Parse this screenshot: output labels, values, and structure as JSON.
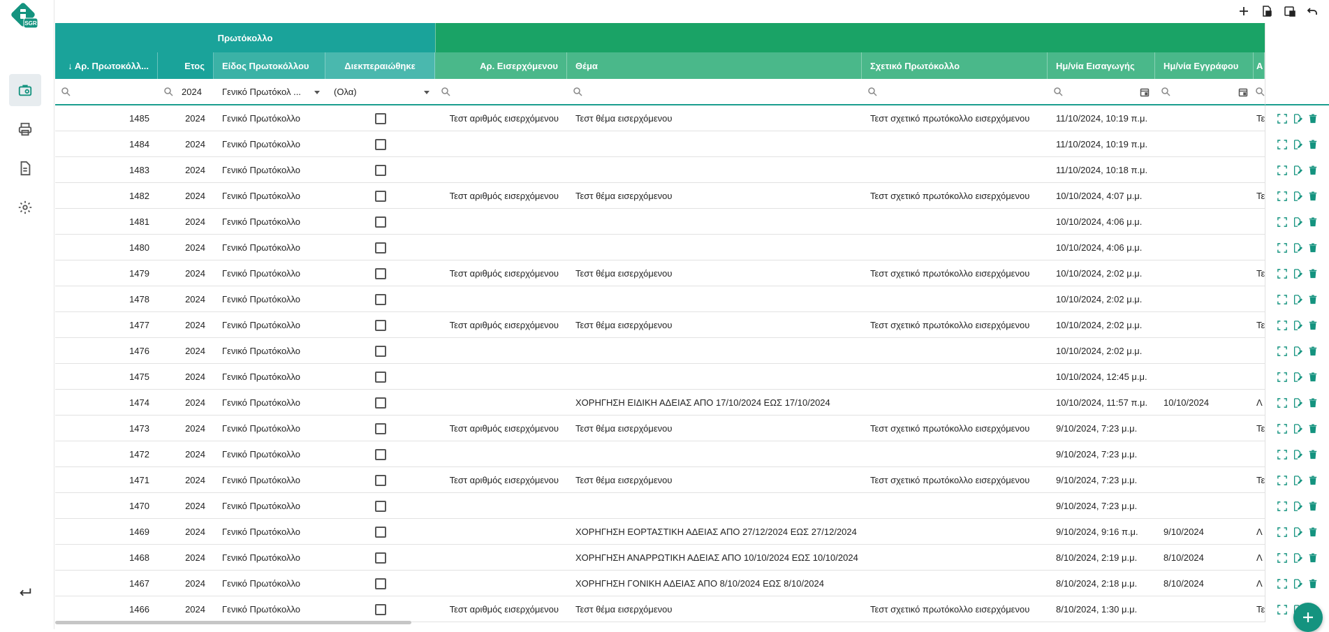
{
  "app": {
    "logo_text": "SGR",
    "accent": "#1a9e8e",
    "accent_dark": "#14937f"
  },
  "sidebar": {
    "items": [
      {
        "icon": "briefcase-icon",
        "active": true
      },
      {
        "icon": "printer-icon",
        "active": false
      },
      {
        "icon": "document-icon",
        "active": false
      },
      {
        "icon": "gear-icon",
        "active": false
      }
    ],
    "bottom_icon": "enter-arrow-icon"
  },
  "toolbar": {
    "icons": [
      "plus-icon",
      "export-icon",
      "layout-icon",
      "undo-icon"
    ]
  },
  "grid": {
    "groups": [
      {
        "label": "Πρωτόκολλο",
        "color": "#1aa39a"
      },
      {
        "label": "",
        "color": "#1aa366"
      }
    ],
    "columns": [
      {
        "label": "↓ Αρ. Πρωτοκόλλ..."
      },
      {
        "label": "Ετος"
      },
      {
        "label": "Είδος Πρωτοκόλλου"
      },
      {
        "label": "Διεκπεραιώθηκε"
      },
      {
        "label": "Αρ. Εισερχόμενου"
      },
      {
        "label": "Θέμα"
      },
      {
        "label": "Σχετικό Πρωτόκολλο"
      },
      {
        "label": "Ημ/νία Εισαγωγής"
      },
      {
        "label": "Ημ/νία Εγγράφου"
      },
      {
        "label": "Α"
      }
    ],
    "filters": {
      "year": "2024",
      "kind": "Γενικό Πρωτόκολ ...",
      "done": "(Ολα)"
    },
    "rows": [
      {
        "no": "1485",
        "year": "2024",
        "kind": "Γενικό Πρωτόκολλο",
        "inc": "Τεστ αριθμός εισερχόμενου",
        "subject": "Τεστ θέμα εισερχόμενου",
        "rel": "Τεστ σχετικό πρωτόκολλο εισερχόμενου",
        "ins": "11/10/2024, 10:19 π.μ.",
        "doc": "",
        "extra": "Τε"
      },
      {
        "no": "1484",
        "year": "2024",
        "kind": "Γενικό Πρωτόκολλο",
        "inc": "",
        "subject": "",
        "rel": "",
        "ins": "11/10/2024, 10:19 π.μ.",
        "doc": "",
        "extra": ""
      },
      {
        "no": "1483",
        "year": "2024",
        "kind": "Γενικό Πρωτόκολλο",
        "inc": "",
        "subject": "",
        "rel": "",
        "ins": "11/10/2024, 10:18 π.μ.",
        "doc": "",
        "extra": ""
      },
      {
        "no": "1482",
        "year": "2024",
        "kind": "Γενικό Πρωτόκολλο",
        "inc": "Τεστ αριθμός εισερχόμενου",
        "subject": "Τεστ θέμα εισερχόμενου",
        "rel": "Τεστ σχετικό πρωτόκολλο εισερχόμενου",
        "ins": "10/10/2024, 4:07 μ.μ.",
        "doc": "",
        "extra": "Τε"
      },
      {
        "no": "1481",
        "year": "2024",
        "kind": "Γενικό Πρωτόκολλο",
        "inc": "",
        "subject": "",
        "rel": "",
        "ins": "10/10/2024, 4:06 μ.μ.",
        "doc": "",
        "extra": ""
      },
      {
        "no": "1480",
        "year": "2024",
        "kind": "Γενικό Πρωτόκολλο",
        "inc": "",
        "subject": "",
        "rel": "",
        "ins": "10/10/2024, 4:06 μ.μ.",
        "doc": "",
        "extra": ""
      },
      {
        "no": "1479",
        "year": "2024",
        "kind": "Γενικό Πρωτόκολλο",
        "inc": "Τεστ αριθμός εισερχόμενου",
        "subject": "Τεστ θέμα εισερχόμενου",
        "rel": "Τεστ σχετικό πρωτόκολλο εισερχόμενου",
        "ins": "10/10/2024, 2:02 μ.μ.",
        "doc": "",
        "extra": "Τε"
      },
      {
        "no": "1478",
        "year": "2024",
        "kind": "Γενικό Πρωτόκολλο",
        "inc": "",
        "subject": "",
        "rel": "",
        "ins": "10/10/2024, 2:02 μ.μ.",
        "doc": "",
        "extra": ""
      },
      {
        "no": "1477",
        "year": "2024",
        "kind": "Γενικό Πρωτόκολλο",
        "inc": "Τεστ αριθμός εισερχόμενου",
        "subject": "Τεστ θέμα εισερχόμενου",
        "rel": "Τεστ σχετικό πρωτόκολλο εισερχόμενου",
        "ins": "10/10/2024, 2:02 μ.μ.",
        "doc": "",
        "extra": "Τε"
      },
      {
        "no": "1476",
        "year": "2024",
        "kind": "Γενικό Πρωτόκολλο",
        "inc": "",
        "subject": "",
        "rel": "",
        "ins": "10/10/2024, 2:02 μ.μ.",
        "doc": "",
        "extra": ""
      },
      {
        "no": "1475",
        "year": "2024",
        "kind": "Γενικό Πρωτόκολλο",
        "inc": "",
        "subject": "",
        "rel": "",
        "ins": "10/10/2024, 12:45 μ.μ.",
        "doc": "",
        "extra": ""
      },
      {
        "no": "1474",
        "year": "2024",
        "kind": "Γενικό Πρωτόκολλο",
        "inc": "",
        "subject": "ΧΟΡΗΓΗΣΗ ΕΙΔΙΚΗ ΑΔΕΙΑΣ ΑΠΟ 17/10/2024 ΕΩΣ 17/10/2024",
        "rel": "",
        "ins": "10/10/2024, 11:57 π.μ.",
        "doc": "10/10/2024",
        "extra": "Λ"
      },
      {
        "no": "1473",
        "year": "2024",
        "kind": "Γενικό Πρωτόκολλο",
        "inc": "Τεστ αριθμός εισερχόμενου",
        "subject": "Τεστ θέμα εισερχόμενου",
        "rel": "Τεστ σχετικό πρωτόκολλο εισερχόμενου",
        "ins": "9/10/2024, 7:23 μ.μ.",
        "doc": "",
        "extra": "Τε"
      },
      {
        "no": "1472",
        "year": "2024",
        "kind": "Γενικό Πρωτόκολλο",
        "inc": "",
        "subject": "",
        "rel": "",
        "ins": "9/10/2024, 7:23 μ.μ.",
        "doc": "",
        "extra": ""
      },
      {
        "no": "1471",
        "year": "2024",
        "kind": "Γενικό Πρωτόκολλο",
        "inc": "Τεστ αριθμός εισερχόμενου",
        "subject": "Τεστ θέμα εισερχόμενου",
        "rel": "Τεστ σχετικό πρωτόκολλο εισερχόμενου",
        "ins": "9/10/2024, 7:23 μ.μ.",
        "doc": "",
        "extra": "Τε"
      },
      {
        "no": "1470",
        "year": "2024",
        "kind": "Γενικό Πρωτόκολλο",
        "inc": "",
        "subject": "",
        "rel": "",
        "ins": "9/10/2024, 7:23 μ.μ.",
        "doc": "",
        "extra": ""
      },
      {
        "no": "1469",
        "year": "2024",
        "kind": "Γενικό Πρωτόκολλο",
        "inc": "",
        "subject": "ΧΟΡΗΓΗΣΗ ΕΟΡΤΑΣΤΙΚΗ ΑΔΕΙΑΣ ΑΠΟ 27/12/2024 ΕΩΣ 27/12/2024",
        "rel": "",
        "ins": "9/10/2024, 9:16 π.μ.",
        "doc": "9/10/2024",
        "extra": "Λ"
      },
      {
        "no": "1468",
        "year": "2024",
        "kind": "Γενικό Πρωτόκολλο",
        "inc": "",
        "subject": "ΧΟΡΗΓΗΣΗ ΑΝΑΡΡΩΤΙΚΗ ΑΔΕΙΑΣ ΑΠΟ 10/10/2024 ΕΩΣ 10/10/2024",
        "rel": "",
        "ins": "8/10/2024, 2:19 μ.μ.",
        "doc": "8/10/2024",
        "extra": "Λ"
      },
      {
        "no": "1467",
        "year": "2024",
        "kind": "Γενικό Πρωτόκολλο",
        "inc": "",
        "subject": "ΧΟΡΗΓΗΣΗ ΓΟΝΙΚΗ ΑΔΕΙΑΣ ΑΠΟ 8/10/2024 ΕΩΣ 8/10/2024",
        "rel": "",
        "ins": "8/10/2024, 2:18 μ.μ.",
        "doc": "8/10/2024",
        "extra": "Λ"
      },
      {
        "no": "1466",
        "year": "2024",
        "kind": "Γενικό Πρωτόκολλο",
        "inc": "Τεστ αριθμός εισερχόμενου",
        "subject": "Τεστ θέμα εισερχόμενου",
        "rel": "Τεστ σχετικό πρωτόκολλο εισερχόμενου",
        "ins": "8/10/2024, 1:30 μ.μ.",
        "doc": "",
        "extra": "Τε"
      }
    ],
    "row_actions": [
      "expand-icon",
      "edit-document-icon",
      "delete-icon"
    ]
  }
}
